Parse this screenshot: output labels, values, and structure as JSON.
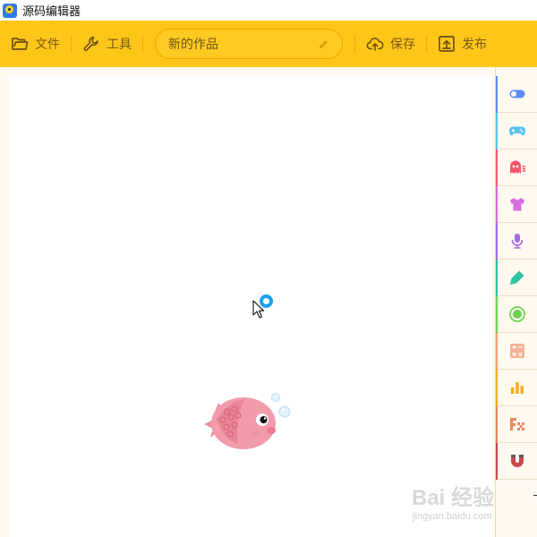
{
  "window": {
    "title": "源码编辑器"
  },
  "toolbar": {
    "file_label": "文件",
    "tools_label": "工具",
    "project_title": "新的作品",
    "save_label": "保存",
    "publish_label": "发布"
  },
  "sidebar": {
    "categories": [
      {
        "icon": "toggle-icon",
        "color": "#5b8def"
      },
      {
        "icon": "gamepad-icon",
        "color": "#55c3f2"
      },
      {
        "icon": "ghost-icon",
        "color": "#f2576b"
      },
      {
        "icon": "tshirt-icon",
        "color": "#d96ce0"
      },
      {
        "icon": "microphone-icon",
        "color": "#a36ae8"
      },
      {
        "icon": "pen-icon",
        "color": "#2ec4a0"
      },
      {
        "icon": "record-icon",
        "color": "#6dd44f"
      },
      {
        "icon": "calculator-icon",
        "color": "#f5a07a"
      },
      {
        "icon": "bar-chart-icon",
        "color": "#f6ac22"
      },
      {
        "icon": "pixel-icon",
        "color": "#ea8664"
      },
      {
        "icon": "magnet-icon",
        "color": "#c9474f"
      }
    ]
  },
  "watermark": {
    "main": "Bai 经验",
    "sub": "jingyan.baidu.com"
  }
}
